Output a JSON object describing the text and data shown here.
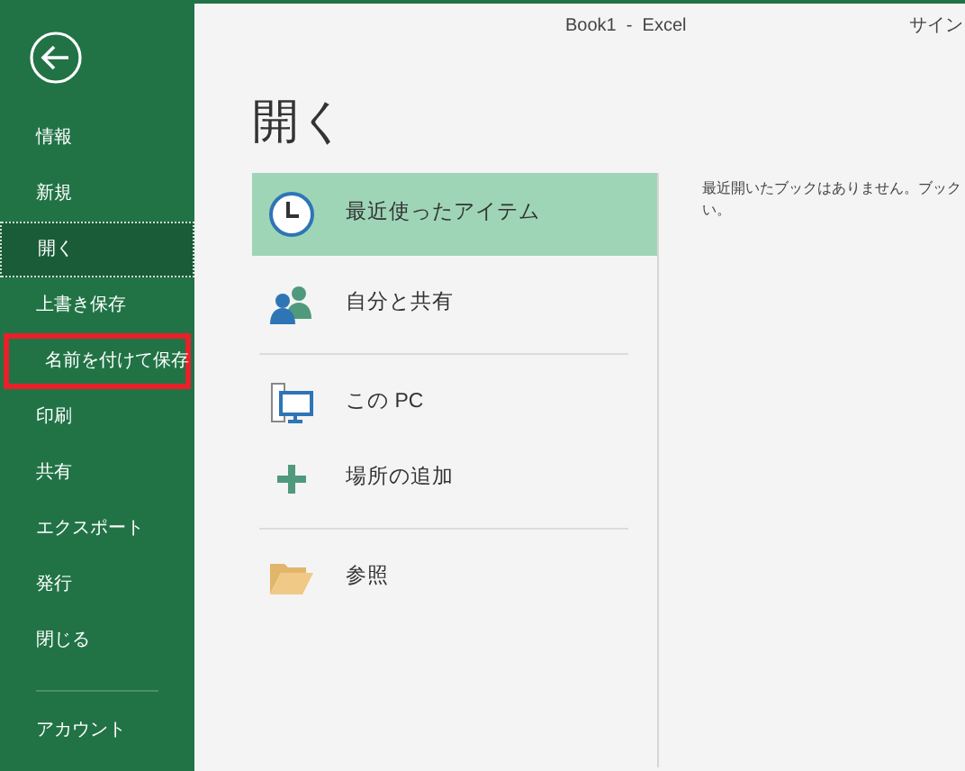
{
  "window": {
    "title": "Book1  -  Excel",
    "signin": "サイン"
  },
  "sidebar": {
    "items": [
      {
        "label": "情報",
        "selected": false,
        "highlighted": false
      },
      {
        "label": "新規",
        "selected": false,
        "highlighted": false
      },
      {
        "label": "開く",
        "selected": true,
        "highlighted": false
      },
      {
        "label": "上書き保存",
        "selected": false,
        "highlighted": false
      },
      {
        "label": "名前を付けて保存",
        "selected": false,
        "highlighted": true
      },
      {
        "label": "印刷",
        "selected": false,
        "highlighted": false
      },
      {
        "label": "共有",
        "selected": false,
        "highlighted": false
      },
      {
        "label": "エクスポート",
        "selected": false,
        "highlighted": false
      },
      {
        "label": "発行",
        "selected": false,
        "highlighted": false
      },
      {
        "label": "閉じる",
        "selected": false,
        "highlighted": false
      }
    ],
    "bottom_items": [
      {
        "label": "アカウント",
        "selected": false
      }
    ]
  },
  "heading": "開く",
  "places": [
    {
      "kind": "recent",
      "label": "最近使ったアイテム",
      "selected": true
    },
    {
      "kind": "shared",
      "label": "自分と共有",
      "selected": false
    },
    {
      "kind": "divider"
    },
    {
      "kind": "pc",
      "label": "この PC",
      "selected": false
    },
    {
      "kind": "add",
      "label": "場所の追加",
      "selected": false
    },
    {
      "kind": "divider"
    },
    {
      "kind": "browse",
      "label": "参照",
      "selected": false
    }
  ],
  "message": [
    "最近開いたブックはありません。ブック",
    "い。"
  ]
}
